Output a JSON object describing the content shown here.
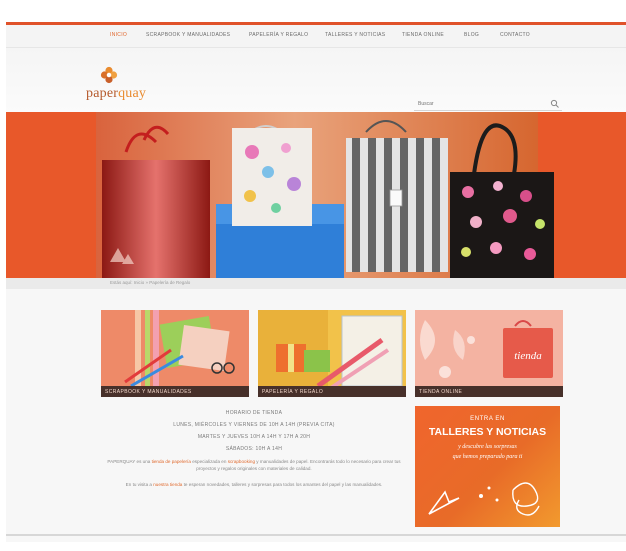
{
  "nav": {
    "items": [
      "Inicio",
      "Scrapbook y Manualidades",
      "Papelería y Regalo",
      "Talleres y Noticias",
      "Tienda Online",
      "Blog",
      "Contacto"
    ],
    "active_index": 0
  },
  "header": {
    "logo_part1": "paper",
    "logo_part2": "quay",
    "search_placeholder": "Buscar"
  },
  "breadcrumb": "Estás aquí: Inicio » Papelería de Regalo",
  "cards": [
    {
      "caption": "SCRAPBOOK Y MANUALIDADES"
    },
    {
      "caption": "PAPELERÍA Y REGALO"
    },
    {
      "caption": "TIENDA ONLINE",
      "badge": "tienda"
    }
  ],
  "intro": {
    "lines": [
      "Horario de Tienda",
      "Lunes, Miércoles y Viernes de 10h a 14h (Previa cita)",
      "Martes y Jueves 10h a 14h y 17h a 20h",
      "Sábados: 10h a 14h"
    ],
    "para1_pre": "PAPERQUAY es una ",
    "para1_hl1": "tienda de papelería",
    "para1_mid": " especializada en ",
    "para1_hl2": "scrapbooking",
    "para1_post": " y manualidades de papel. Encontrarás todo lo necesario para crear tus proyectos y regalos originales con materiales de calidad.",
    "para2_pre": "En tu visita a ",
    "para2_hl": "nuestra tienda",
    "para2_post": " te esperan novedades, talleres y sorpresas para todos los amantes del papel y las manualidades."
  },
  "promo": {
    "line1": "ENTRA EN",
    "line2": "TALLERES Y NOTICIAS",
    "line3": "y descubre las sorpresas",
    "line4": "que hemos preparado para ti"
  },
  "colors": {
    "accent": "#e0522a",
    "orange": "#e86b28",
    "caption_bg": "#47302a"
  }
}
